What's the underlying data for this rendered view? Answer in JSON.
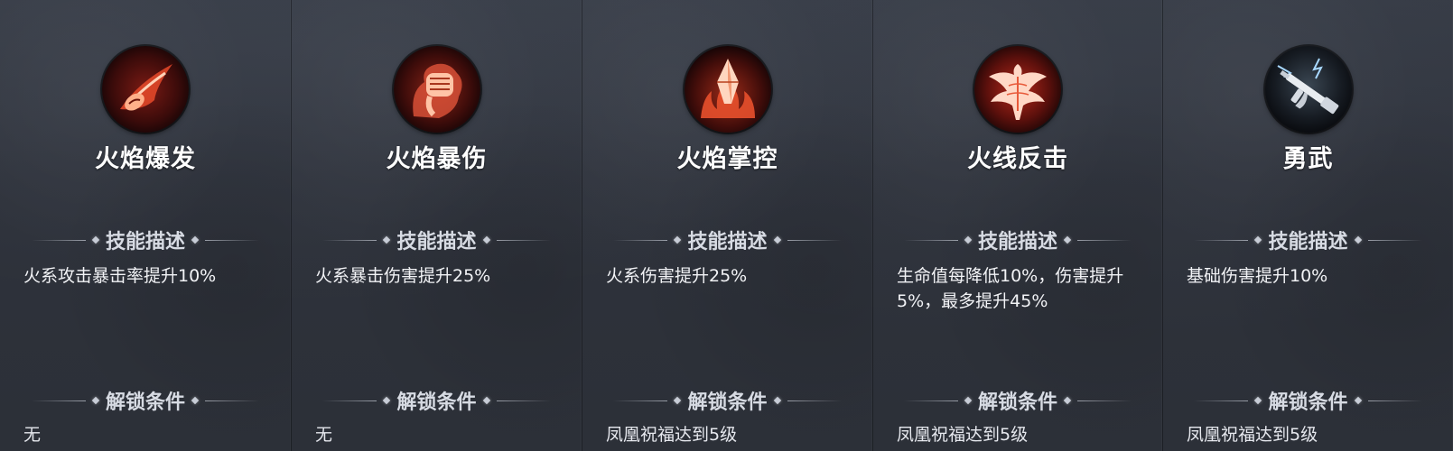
{
  "section_titles": {
    "description": "技能描述",
    "unlock": "解锁条件"
  },
  "skills": [
    {
      "name": "火焰爆发",
      "icon": "flame-burst-icon",
      "description": "火系攻击暴击率提升10%",
      "unlock": "无"
    },
    {
      "name": "火焰暴伤",
      "icon": "flame-fist-icon",
      "description": "火系暴击伤害提升25%",
      "unlock": "无"
    },
    {
      "name": "火焰掌控",
      "icon": "flame-crystal-icon",
      "description": "火系伤害提升25%",
      "unlock": "凤凰祝福达到5级"
    },
    {
      "name": "火线反击",
      "icon": "phoenix-icon",
      "description": "生命值每降低10%，伤害提升5%，最多提升45%",
      "unlock": "凤凰祝福达到5级"
    },
    {
      "name": "勇武",
      "icon": "rifle-icon",
      "description": "基础伤害提升10%",
      "unlock": "凤凰祝福达到5级"
    }
  ],
  "colors": {
    "background": "#2c3038",
    "fire_red": "#c0281c",
    "text_white": "#ffffff",
    "header_grey": "#d7dbe3"
  }
}
